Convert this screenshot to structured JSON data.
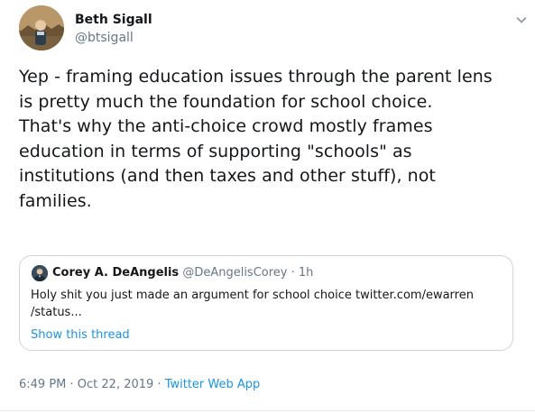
{
  "author": {
    "display_name": "Beth Sigall",
    "handle": "@btsigall"
  },
  "tweet_text_lines": [
    "Yep - framing education issues through the parent lens",
    "is pretty much the foundation for school choice.",
    "That's why the anti-choice crowd mostly frames",
    "education in terms of supporting \"schools\" as",
    "institutions (and then taxes and other stuff), not",
    "families."
  ],
  "quoted_tweet": {
    "display_name": "Corey A. DeAngelis",
    "handle_time": "@DeAngelisCorey · 1h",
    "text_lines": [
      "Holy shit you just made an argument for school choice twitter.com/ewarren",
      "/status..."
    ],
    "show_thread_label": "Show this thread"
  },
  "meta": {
    "time": "6:49 PM",
    "separator1": " · ",
    "date": "Oct 22, 2019",
    "separator2": " · ",
    "source": "Twitter Web App"
  },
  "icons": {
    "caret": "chevron-down-icon",
    "author_avatar": "avatar",
    "quoted_avatar": "avatar"
  },
  "colors": {
    "text_primary": "#14171a",
    "text_secondary": "#657786",
    "link": "#1b95e0",
    "border": "#ccd6dd"
  }
}
